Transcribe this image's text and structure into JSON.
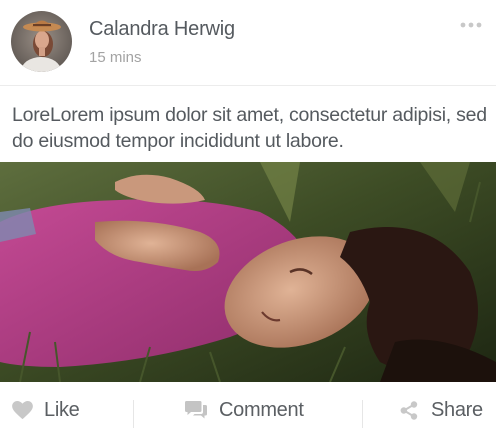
{
  "post": {
    "author": "Calandra Herwig",
    "time": "15 mins",
    "text": "LoreLorem ipsum dolor sit amet, consectetur adipisi, sed do eiusmod tempor incididunt ut labore."
  },
  "actions": {
    "like": "Like",
    "comment": "Comment",
    "share": "Share"
  },
  "icons": {
    "more": "more-dots-icon",
    "like": "heart-icon",
    "comment": "comment-icon",
    "share": "share-icon"
  },
  "colors": {
    "text": "#555a5f",
    "muted": "#a3a3a3",
    "icon": "#c4c4c4"
  }
}
